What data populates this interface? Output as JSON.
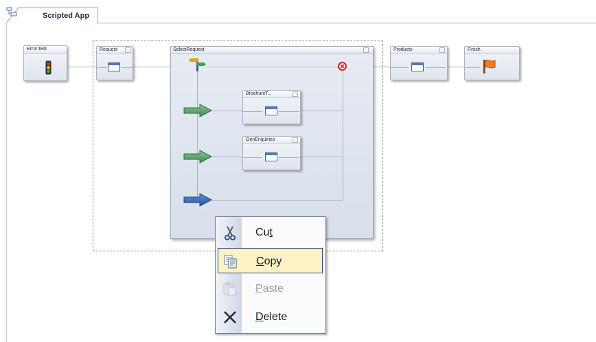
{
  "tab": {
    "label": "Scripted App",
    "icon": "tree-icon"
  },
  "nodes": {
    "error_test": {
      "label": "Error test"
    },
    "request": {
      "label": "Request"
    },
    "select_request": {
      "label": "SelectRequest"
    },
    "brochure": {
      "label": "BrochureT..."
    },
    "gen_enquiries": {
      "label": "GenEnquiries"
    },
    "products": {
      "label": "Products"
    },
    "finish": {
      "label": "Finish"
    }
  },
  "context_menu": {
    "items": [
      {
        "label": "Cut",
        "icon": "scissors-icon",
        "enabled": true,
        "highlighted": false
      },
      {
        "label": "Copy",
        "icon": "copy-icon",
        "enabled": true,
        "highlighted": true
      },
      {
        "label": "Paste",
        "icon": "paste-icon",
        "enabled": false,
        "highlighted": false
      },
      {
        "label": "Delete",
        "icon": "delete-x-icon",
        "enabled": true,
        "highlighted": false
      }
    ]
  },
  "colors": {
    "arrow_green": "#4f9b63",
    "arrow_blue": "#2d5fa8",
    "highlight": "#fbf3c5",
    "error_red": "#d42020"
  }
}
